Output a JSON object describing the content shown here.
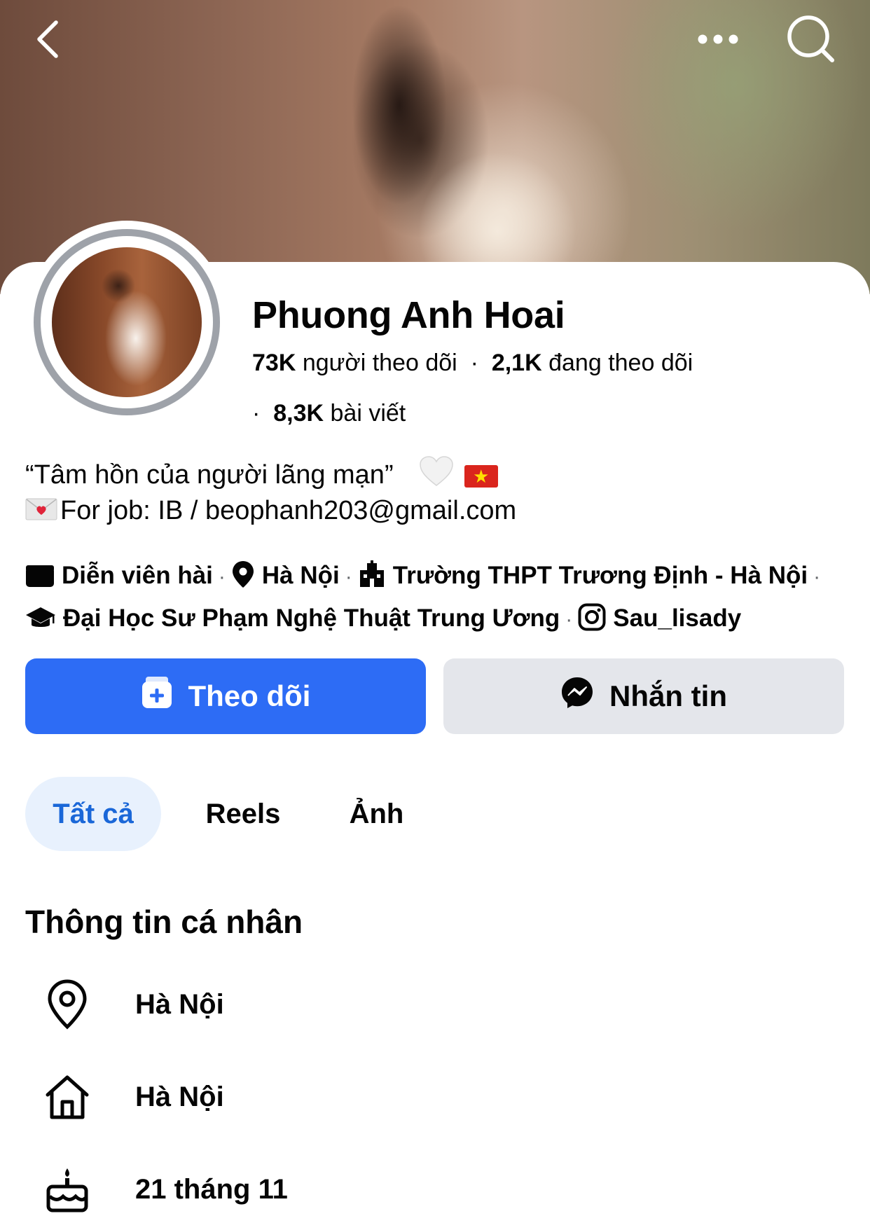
{
  "cover": {
    "description_icons": [
      "back-arrow-icon",
      "more-dots-icon",
      "search-icon"
    ]
  },
  "profile": {
    "name": "Phuong Anh Hoai",
    "followers_count": "73K",
    "followers_label": "người theo dõi",
    "following_count": "2,1K",
    "following_label": "đang theo dõi",
    "posts_count": "8,3K",
    "posts_label": "bài viết"
  },
  "bio": {
    "line1": "“Tâm hồn của người lãng mạn”",
    "line1_flag": "★",
    "line2": "For job: IB / beophanh203@gmail.com"
  },
  "details": {
    "category": "Diễn viên hài",
    "location": "Hà Nội",
    "school": "Trường THPT Trương Định - Hà Nội",
    "university": "Đại Học Sư Phạm Nghệ Thuật Trung Ương",
    "instagram": "Sau_lisady"
  },
  "actions": {
    "follow_label": "Theo dõi",
    "message_label": "Nhắn tin"
  },
  "tabs": [
    {
      "label": "Tất cả",
      "active": true
    },
    {
      "label": "Reels",
      "active": false
    },
    {
      "label": "Ảnh",
      "active": false
    }
  ],
  "personal_info": {
    "title": "Thông tin cá nhân",
    "rows": [
      {
        "icon": "location-pin-icon",
        "text": "Hà Nội"
      },
      {
        "icon": "home-icon",
        "text": "Hà Nội"
      },
      {
        "icon": "birthday-cake-icon",
        "text": "21 tháng 11"
      }
    ]
  },
  "colors": {
    "primary_blue": "#2d6cf5",
    "secondary_button": "#e4e6eb",
    "active_tab_bg": "#e8f1fd",
    "active_tab_text": "#1a67d8",
    "text": "#050505",
    "muted": "#65676b"
  }
}
